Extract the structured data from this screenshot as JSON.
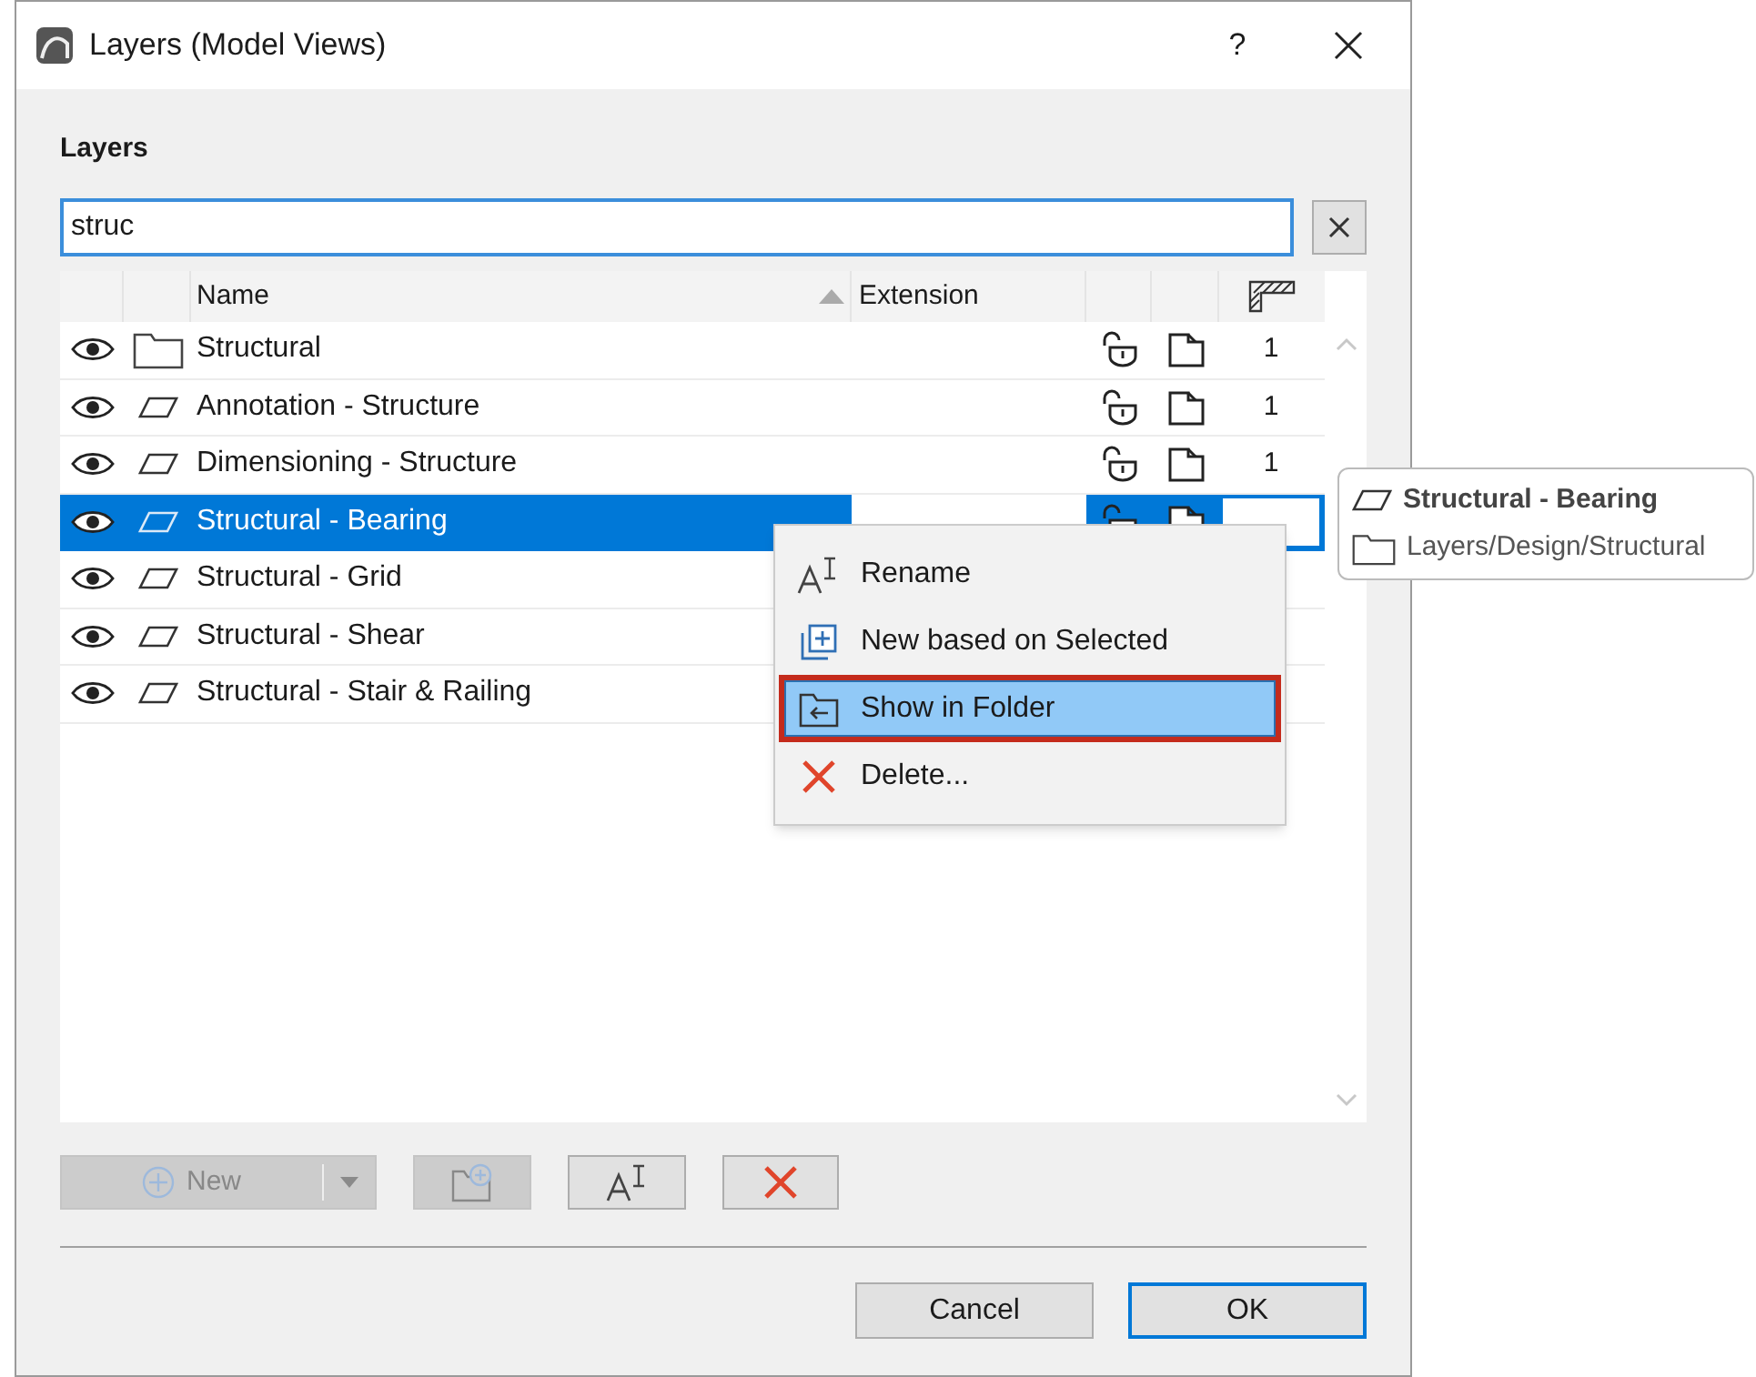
{
  "window": {
    "title": "Layers (Model Views)",
    "help": "?"
  },
  "section_title": "Layers",
  "search": {
    "value": "struc"
  },
  "table": {
    "columns": [
      {
        "label": "Name",
        "sorted": true
      },
      {
        "label": "Extension",
        "sorted": false
      }
    ],
    "rows": [
      {
        "kind": "folder",
        "name": "Structural",
        "selected": false,
        "number": "1"
      },
      {
        "kind": "layer",
        "name": "Annotation - Structure",
        "selected": false,
        "number": "1"
      },
      {
        "kind": "layer",
        "name": "Dimensioning - Structure",
        "selected": false,
        "number": "1"
      },
      {
        "kind": "layer",
        "name": "Structural - Bearing",
        "selected": true
      },
      {
        "kind": "layer",
        "name": "Structural - Grid",
        "selected": false
      },
      {
        "kind": "layer",
        "name": "Structural - Shear",
        "selected": false
      },
      {
        "kind": "layer",
        "name": "Structural - Stair & Railing",
        "selected": false
      }
    ]
  },
  "context_menu": [
    {
      "kind": "rename",
      "label": "Rename",
      "selected": false
    },
    {
      "kind": "new",
      "label": "New based on Selected",
      "selected": false
    },
    {
      "kind": "show",
      "label": "Show in Folder",
      "selected": true
    },
    {
      "kind": "delete",
      "label": "Delete...",
      "selected": false
    }
  ],
  "tooltip": {
    "title": "Structural - Bearing",
    "path": "Layers/Design/Structural"
  },
  "toolbar": {
    "new_label": "New",
    "new_disabled": true,
    "folder_disabled": true
  },
  "buttons": [
    {
      "label": "Cancel",
      "default": false
    },
    {
      "label": "OK",
      "default": true
    }
  ]
}
